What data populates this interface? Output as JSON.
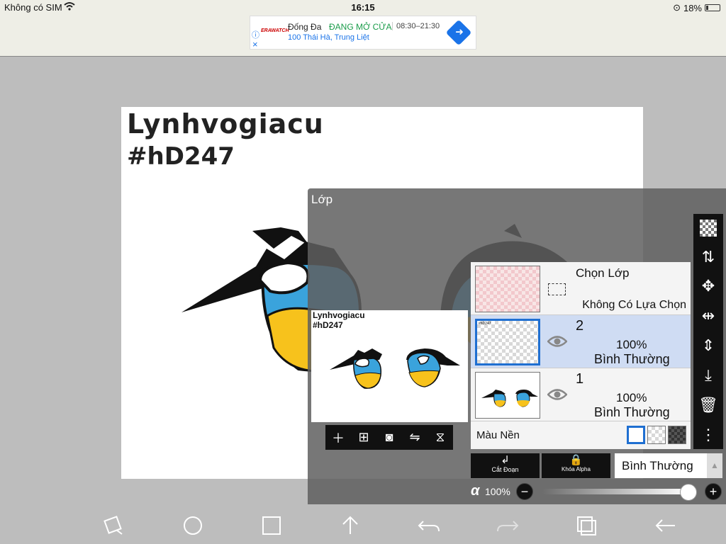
{
  "status_bar": {
    "carrier": "Không có SIM",
    "time": "16:15",
    "battery": "18%"
  },
  "ad": {
    "logo": "ERAWATCH",
    "name": "Đống Đa",
    "open_status": "ĐANG MỞ CỬA",
    "hours": "08:30–21:30",
    "address": "100 Thái Hà, Trung Liệt",
    "close": "×"
  },
  "canvas": {
    "signature_line1": "Lynhvogiacu",
    "signature_line2": "#hD247"
  },
  "layer_panel": {
    "title": "Lớp",
    "preview_signature_line1": "Lynhvogiacu",
    "preview_signature_line2": "#hD247",
    "preview_tools": [
      "+",
      "⊞",
      "camera-icon",
      "flip-icon",
      "merge-icon"
    ],
    "select_layer": {
      "title": "Chọn Lớp",
      "subtitle": "Không Có Lựa Chọn"
    },
    "layers": [
      {
        "number": "2",
        "opacity": "100%",
        "blend": "Bình Thường",
        "selected": true
      },
      {
        "number": "1",
        "opacity": "100%",
        "blend": "Bình Thường",
        "selected": false
      }
    ],
    "background": {
      "label": "Màu Nền",
      "swatches": [
        "white",
        "checker",
        "dark-checker"
      ],
      "selected": "white"
    },
    "side_tools": [
      "checker-icon",
      "transfer-icon",
      "move-icon",
      "flip-horizontal-icon",
      "flip-vertical-icon",
      "merge-down-icon",
      "trash-icon",
      "more-icon"
    ],
    "clipping_label": "Cắt Đoạn",
    "alpha_lock_label": "Khóa Alpha",
    "blend_mode": "Bình Thường",
    "alpha_symbol": "α",
    "opacity": "100%",
    "opacity_fraction": 1.0
  },
  "bottom_toolbar": [
    "transform-icon",
    "ellipse-icon",
    "rectangle-icon",
    "arrow-up-icon",
    "undo-icon",
    "redo-icon",
    "layers-icon",
    "back-icon"
  ],
  "colors": {
    "accent": "#1f6fd1",
    "eye_blue": "#3aa3dc",
    "eye_yellow": "#f7c21c",
    "ad_green": "#1a9c4a"
  }
}
